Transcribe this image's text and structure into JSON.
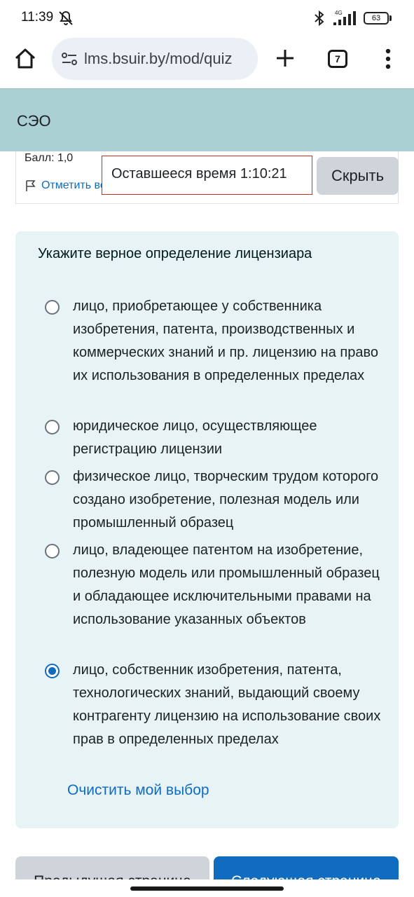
{
  "status_bar": {
    "time": "11:39",
    "network": "4G",
    "battery": "63"
  },
  "browser": {
    "url": "lms.bsuir.by/mod/quiz",
    "tab_count": "7"
  },
  "header": {
    "site_name": "СЭО"
  },
  "question_info": {
    "grade": "Балл: 1,0",
    "flag_label": "Отметить вопрос"
  },
  "timer": {
    "label": "Оставшееся время 1:10:21",
    "hide_label": "Скрыть"
  },
  "question": {
    "text": "Укажите верное определение лицензиара",
    "answers": [
      {
        "label": "лицо, приобретающее у собственника изобретения, патента, производственных и коммерческих знаний и пр. лицензию на право их использования в определенных пределах",
        "selected": false
      },
      {
        "label": "юридическое лицо, осуществляющее регистрацию лицензии",
        "selected": false
      },
      {
        "label": "физическое лицо, творческим трудом которого создано изобретение, полезная модель или промышленный образец",
        "selected": false
      },
      {
        "label": "лицо, владеющее патентом на изобретение, полезную модель или промышленный образец и обладающее исключительными правами на использование указанных объектов",
        "selected": false
      },
      {
        "label": "лицо, собственник изобретения, патента, технологических знаний, выдающий своему контрагенту лицензию на использование своих прав в определенных пределах",
        "selected": true
      }
    ],
    "clear_label": "Очистить мой выбор"
  },
  "navigation": {
    "prev_label": "Предыдущая страница",
    "next_label": "Следующая страница"
  },
  "colors": {
    "header_bg": "#abd0d4",
    "panel_bg": "#e7f3f5",
    "primary": "#0f6cbf",
    "timer_border": "#ca3120",
    "secondary_btn": "#ced4da"
  }
}
